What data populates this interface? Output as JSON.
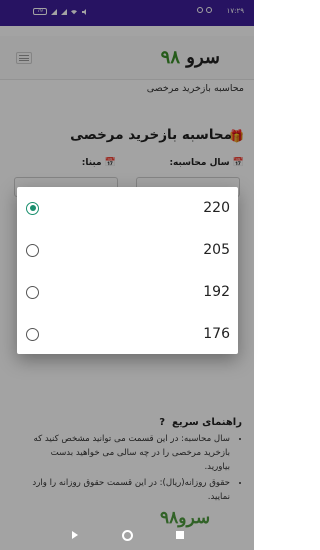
{
  "statusbar": {
    "time": "۱۷:۲۹",
    "battery": "79"
  },
  "app": {
    "brand_word": "سرو",
    "brand_num": "۹۸",
    "breadcrumb": "محاسبه بازخرید مرخصی"
  },
  "page": {
    "title": "محاسبه بازخرید مرخصی",
    "year_label": "سال محاسبه:",
    "base_label": "مبنا:"
  },
  "help": {
    "title": "راهنمای سریع",
    "items": [
      "سال محاسبه: در این قسمت می توانید مشخص کنید که بازخرید مرخصی را در چه سالی می خواهید بدست بیاورید.",
      "حقوق روزانه(ریال): در این قسمت حقوق روزانه را وارد نمایید."
    ]
  },
  "dialog": {
    "options": [
      {
        "value": "220",
        "selected": true
      },
      {
        "value": "205",
        "selected": false
      },
      {
        "value": "192",
        "selected": false
      },
      {
        "value": "176",
        "selected": false
      }
    ]
  },
  "colors": {
    "statusbar": "#3d1f99",
    "brand_green": "#3b8f2a",
    "radio_selected": "#1a8f6e"
  }
}
